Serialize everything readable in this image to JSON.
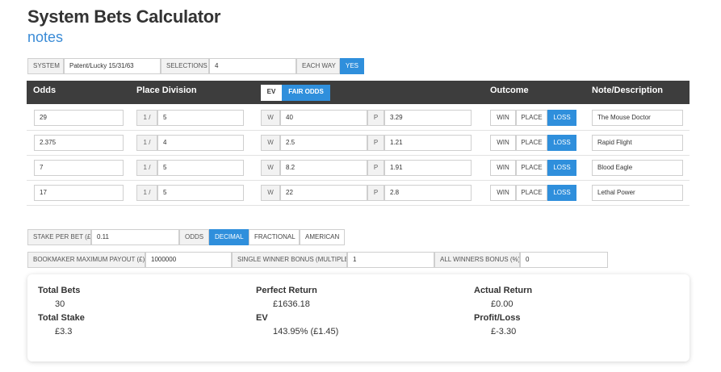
{
  "page": {
    "title": "System Bets Calculator",
    "subtitle": "notes"
  },
  "system_bar": {
    "system_label": "SYSTEM",
    "system_value": "Patent/Lucky 15/31/63",
    "selections_label": "SELECTIONS",
    "selections_value": "4",
    "each_way_label": "EACH WAY",
    "each_way_value": "YES"
  },
  "table": {
    "headers": {
      "odds": "Odds",
      "place_division": "Place Division",
      "outcome": "Outcome",
      "note": "Note/Description"
    },
    "ev_toggle": {
      "ev": "EV",
      "fair_odds": "FAIR ODDS"
    },
    "place_prefix": "1 /",
    "win_prefix": "W",
    "place_odds_prefix": "P",
    "outcome_options": [
      "WIN",
      "PLACE",
      "LOSS"
    ],
    "rows": [
      {
        "odds": "29",
        "place_div": "5",
        "win": "40",
        "place": "3.29",
        "outcome": "LOSS",
        "note": "The Mouse Doctor"
      },
      {
        "odds": "2.375",
        "place_div": "4",
        "win": "2.5",
        "place": "1.21",
        "outcome": "LOSS",
        "note": "Rapid Flight"
      },
      {
        "odds": "7",
        "place_div": "5",
        "win": "8.2",
        "place": "1.91",
        "outcome": "LOSS",
        "note": "Blood Eagle"
      },
      {
        "odds": "17",
        "place_div": "5",
        "win": "22",
        "place": "2.8",
        "outcome": "LOSS",
        "note": "Lethal Power"
      }
    ]
  },
  "stake_bar": {
    "stake_label": "STAKE PER BET (£)",
    "stake_value": "0.11",
    "odds_label": "ODDS",
    "odds_formats": [
      "DECIMAL",
      "FRACTIONAL",
      "AMERICAN"
    ],
    "selected_format": "DECIMAL"
  },
  "bonus_bar": {
    "max_payout_label": "BOOKMAKER MAXIMUM PAYOUT (£)",
    "max_payout_value": "1000000",
    "single_bonus_label": "SINGLE WINNER BONUS (MULTIPLE)",
    "single_bonus_value": "1",
    "all_bonus_label": "ALL WINNERS BONUS (%)",
    "all_bonus_value": "0"
  },
  "summary": {
    "total_bets_label": "Total Bets",
    "total_bets": "30",
    "total_stake_label": "Total Stake",
    "total_stake": "£3.3",
    "perfect_return_label": "Perfect Return",
    "perfect_return": "£1636.18",
    "ev_label": "EV",
    "ev": "143.95% (£1.45)",
    "actual_return_label": "Actual Return",
    "actual_return": "£0.00",
    "profit_loss_label": "Profit/Loss",
    "profit_loss": "£-3.30"
  },
  "colors": {
    "accent": "#2f8fdc",
    "header_bg": "#3d3d3d",
    "subtitle": "#3a8bd6"
  }
}
